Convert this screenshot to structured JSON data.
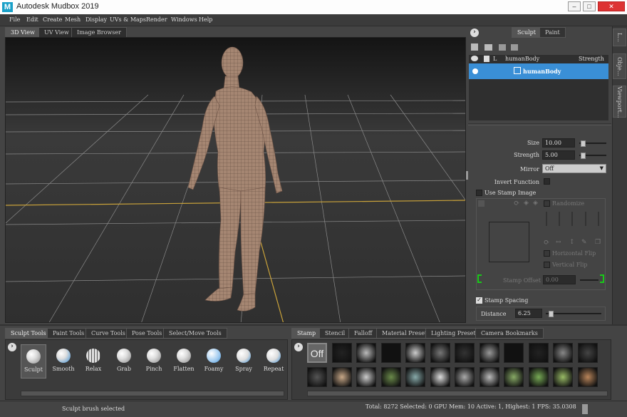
{
  "window": {
    "title": "Autodesk Mudbox 2019",
    "logo": "M",
    "minimize": "–",
    "maximize": "□",
    "close": "✕"
  },
  "menu": [
    "File",
    "Edit",
    "Create",
    "Mesh",
    "Display",
    "UVs & Maps",
    "Render",
    "Windows",
    "Help"
  ],
  "view_tabs": [
    "3D View",
    "UV View",
    "Image Browser"
  ],
  "right_tabs": [
    "Sculpt",
    "Paint"
  ],
  "side_tabs": [
    "L...",
    "Obje...",
    "Viewport..."
  ],
  "layers": {
    "header_l": "L",
    "header_name": "humanBody",
    "header_strength": "Strength",
    "item": "humanBody"
  },
  "props": {
    "size_label": "Size",
    "size_value": "10.00",
    "strength_label": "Strength",
    "strength_value": "5.00",
    "mirror_label": "Mirror",
    "mirror_value": "Off",
    "invert_label": "Invert Function",
    "use_stamp_label": "Use Stamp Image",
    "randomize_label": "Randomize",
    "hflip_label": "Horizontal Flip",
    "vflip_label": "Vertical Flip",
    "stamp_offset_label": "Stamp Offset",
    "stamp_offset_value": "0.00",
    "stamp_spacing_label": "Stamp Spacing",
    "distance_label": "Distance",
    "distance_value": "6.25"
  },
  "sliders": {
    "size": 0.05,
    "strength": 0.05,
    "distance": 0.05
  },
  "tool_tabs": [
    "Sculpt Tools",
    "Paint Tools",
    "Curve Tools",
    "Pose Tools",
    "Select/Move Tools"
  ],
  "tools": [
    "Sculpt",
    "Smooth",
    "Relax",
    "Grab",
    "Pinch",
    "Flatten",
    "Foamy",
    "Spray",
    "Repeat"
  ],
  "stamp_tabs": [
    "Stamp",
    "Stencil",
    "Falloff",
    "Material Presets",
    "Lighting Presets",
    "Camera Bookmarks"
  ],
  "stamp_off": "Off",
  "status": {
    "left": "Sculpt brush selected",
    "right": "Total: 8272  Selected: 0 GPU Mem: 10  Active: 1, Highest: 1  FPS: 35.0308"
  },
  "colors": {
    "selection": "#3a8fd6",
    "skin": "#a58672",
    "grid": "#c9a23a"
  }
}
